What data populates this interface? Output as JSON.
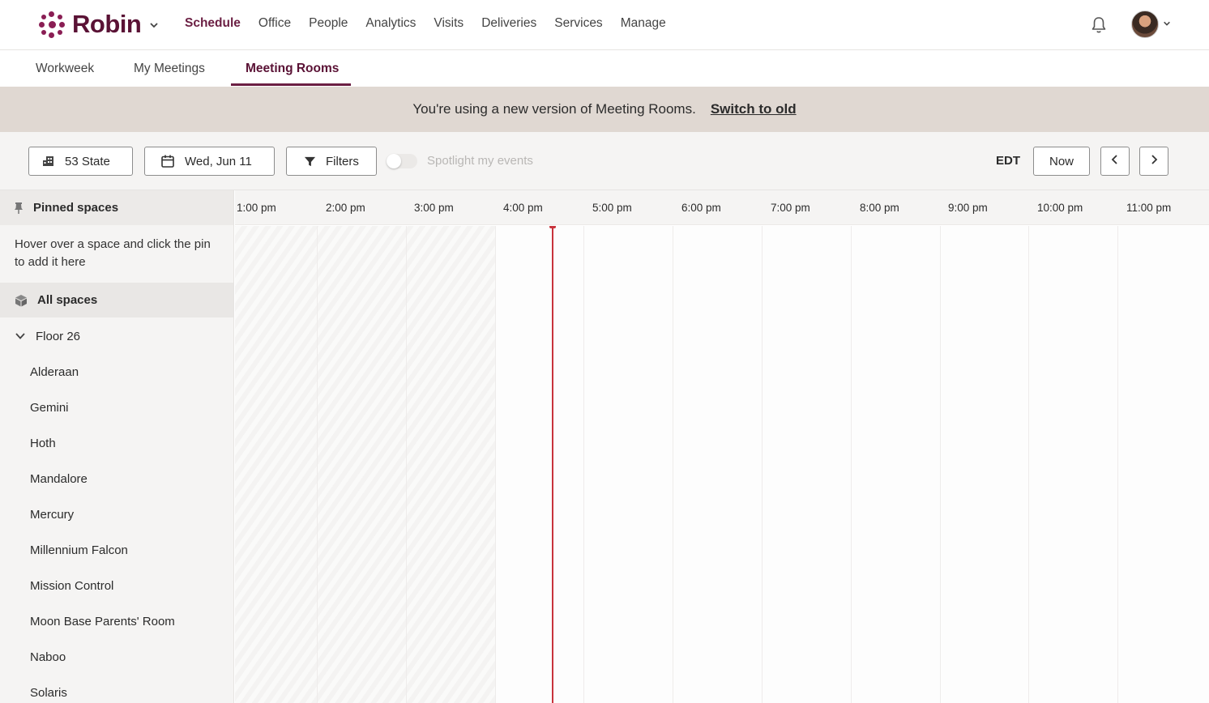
{
  "app": {
    "name": "Robin"
  },
  "nav": {
    "items": [
      "Schedule",
      "Office",
      "People",
      "Analytics",
      "Visits",
      "Deliveries",
      "Services",
      "Manage"
    ],
    "active": "Schedule"
  },
  "subtabs": {
    "items": [
      "Workweek",
      "My Meetings",
      "Meeting Rooms"
    ],
    "active": "Meeting Rooms"
  },
  "banner": {
    "message": "You're using a new version of Meeting Rooms.",
    "link": "Switch to old"
  },
  "toolbar": {
    "location": "53 State",
    "date": "Wed, Jun 11",
    "filters": "Filters",
    "spotlight_label": "Spotlight my events",
    "spotlight_on": false,
    "timezone": "EDT",
    "now": "Now"
  },
  "sidebar": {
    "pinned_title": "Pinned spaces",
    "pinned_hint": "Hover over a space and click the pin to add it here",
    "all_spaces": "All spaces",
    "floor": "Floor 26",
    "rooms": [
      "Alderaan",
      "Gemini",
      "Hoth",
      "Mandalore",
      "Mercury",
      "Millennium Falcon",
      "Mission Control",
      "Moon Base Parents' Room",
      "Naboo",
      "Solaris"
    ]
  },
  "timeline": {
    "hours": [
      "1:00 pm",
      "2:00 pm",
      "3:00 pm",
      "4:00 pm",
      "5:00 pm",
      "6:00 pm",
      "7:00 pm",
      "8:00 pm",
      "9:00 pm",
      "10:00 pm",
      "11:00 pm"
    ]
  },
  "colors": {
    "brand": "#8a1e54",
    "brand_dark": "#5a1235",
    "now_line": "#c8333c",
    "banner_bg": "#e0d8d2"
  }
}
